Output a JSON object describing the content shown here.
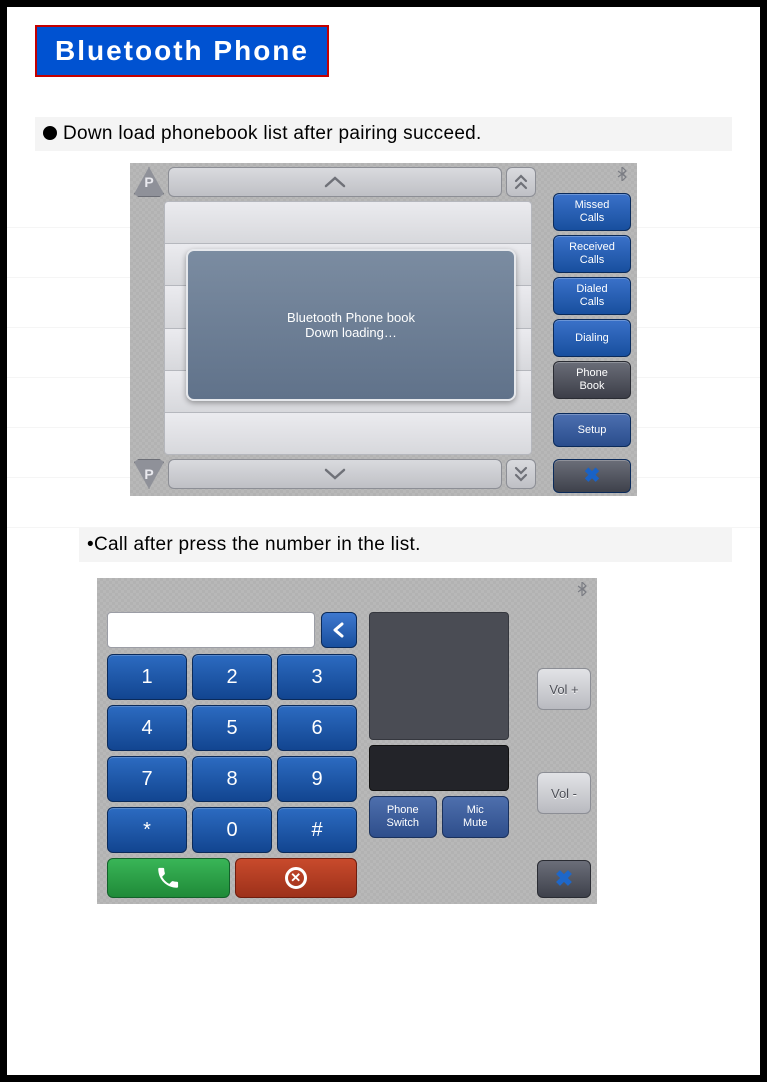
{
  "title": "Bluetooth Phone",
  "bullet1": "Down load phonebook list after pairing succeed.",
  "bullet2": "•Call after press the number in the list.",
  "screen1": {
    "page_indicator": "P",
    "sidebar": [
      "Missed\nCalls",
      "Received\nCalls",
      "Dialed\nCalls",
      "Dialing",
      "Phone\nBook"
    ],
    "sidebar_active_index": 4,
    "setup_label": "Setup",
    "close_label": "✖",
    "overlay_line1": "Bluetooth Phone book",
    "overlay_line2": "Down loading…"
  },
  "screen2": {
    "backspace_label": "<",
    "keypad": [
      "1",
      "2",
      "3",
      "4",
      "5",
      "6",
      "7",
      "8",
      "9",
      "*",
      "0",
      "#"
    ],
    "phone_switch_label": "Phone\nSwitch",
    "mic_mute_label": "Mic\nMute",
    "vol_up_label": "Vol +",
    "vol_down_label": "Vol -",
    "close_label": "✖"
  }
}
